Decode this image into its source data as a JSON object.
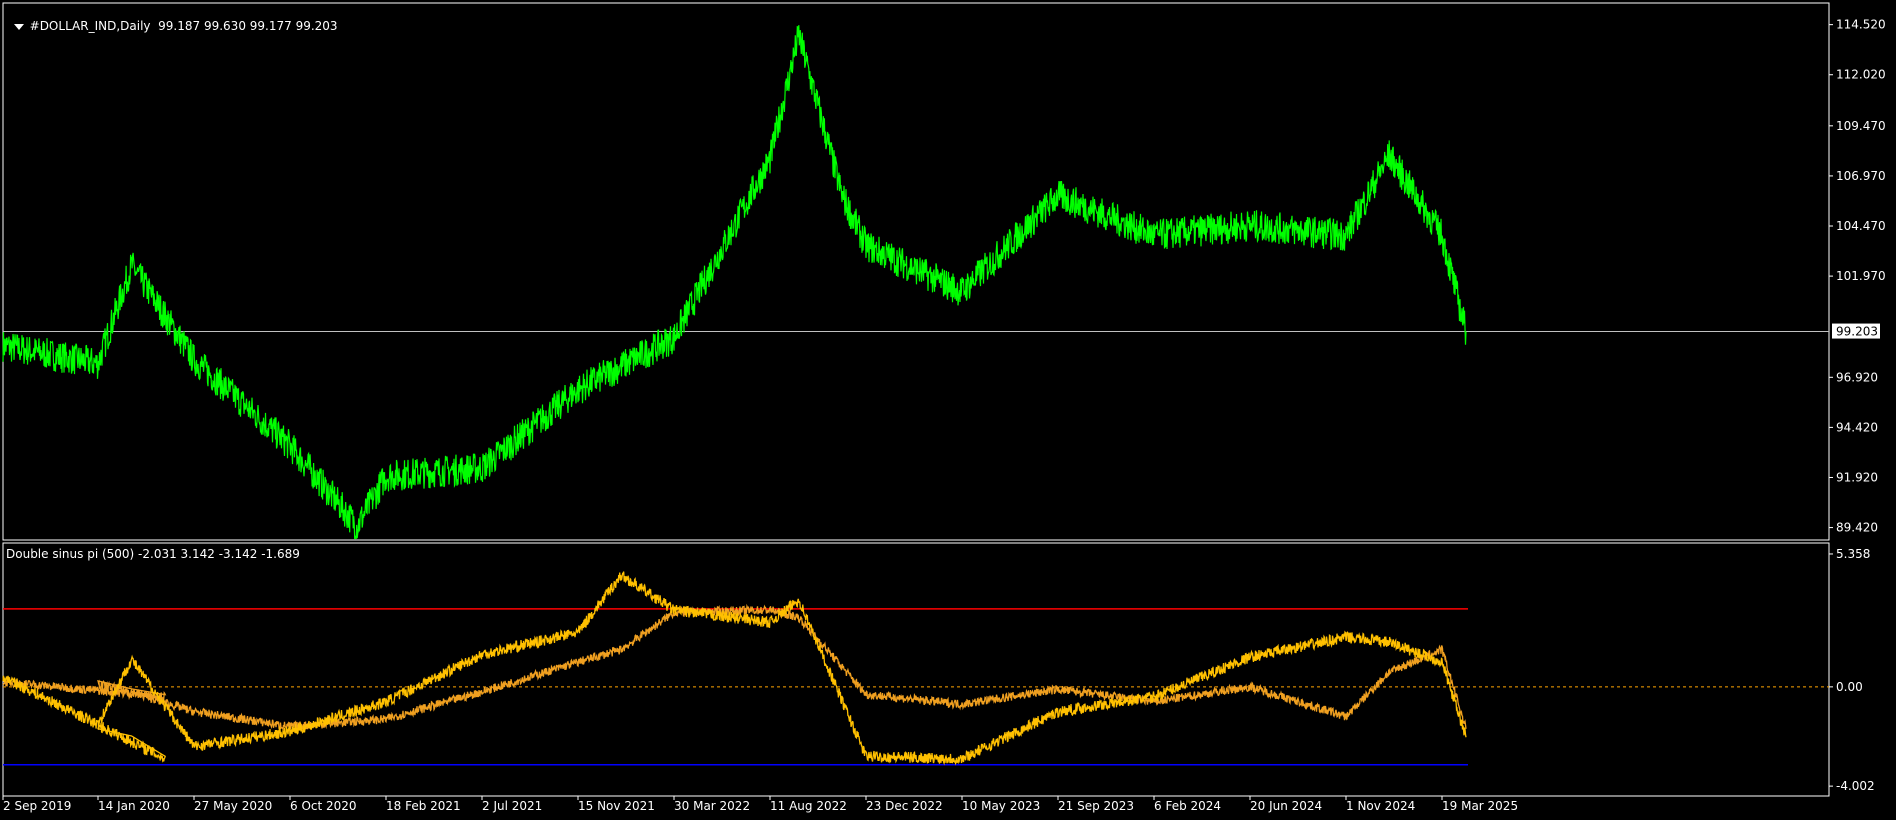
{
  "main_panel": {
    "symbol": "#DOLLAR_IND,Daily",
    "ohlc": "99.187 99.630 99.177 99.203",
    "current_price_label": "99.203",
    "current_price": 99.203
  },
  "indicator_panel": {
    "title": "Double sinus pi (500) -2.031 3.142 -3.142 -1.689"
  },
  "colors": {
    "background": "#000000",
    "frame": "#ffffff",
    "price_line": "#00ff00",
    "current_price_line": "#c0c0c0",
    "indicator_line_1": "#ffc000",
    "indicator_line_2": "#f0a020",
    "upper_level": "#ff0000",
    "lower_level": "#0000ff",
    "zero_level": "#ffa500"
  },
  "chart_data": [
    {
      "type": "line",
      "title": "#DOLLAR_IND,Daily",
      "y_ticks": [
        "114.520",
        "112.020",
        "109.470",
        "106.970",
        "104.470",
        "101.970",
        "99.203",
        "96.920",
        "94.420",
        "91.920",
        "89.420"
      ],
      "y_tick_values": [
        114.52,
        112.02,
        109.47,
        106.97,
        104.47,
        101.97,
        99.203,
        96.92,
        94.42,
        91.92,
        89.42
      ],
      "ylim": [
        88.8,
        115.6
      ],
      "x_tick_labels": [
        "2 Sep 2019",
        "14 Jan 2020",
        "27 May 2020",
        "6 Oct 2020",
        "18 Feb 2021",
        "2 Jul 2021",
        "15 Nov 2021",
        "30 Mar 2022",
        "11 Aug 2022",
        "23 Dec 2022",
        "10 May 2023",
        "21 Sep 2023",
        "6 Feb 2024",
        "20 Jun 2024",
        "1 Nov 2024",
        "19 Mar 2025"
      ],
      "series": [
        {
          "x": [
            "2 Sep 2019",
            "14 Jan 2020",
            "Mar 2020",
            "27 May 2020",
            "6 Oct 2020",
            "Jan 2021",
            "18 Feb 2021",
            "2 Jul 2021",
            "15 Nov 2021",
            "30 Mar 2022",
            "11 Aug 2022",
            "Sep 2022",
            "Nov 2022",
            "23 Dec 2022",
            "10 May 2023",
            "21 Sep 2023",
            "6 Feb 2024",
            "20 Jun 2024",
            "1 Nov 2024",
            "Jan 2025",
            "19 Mar 2025",
            "Apr 2025"
          ],
          "values": [
            98.5,
            97.6,
            102.5,
            97.8,
            93.5,
            89.5,
            92.0,
            92.4,
            96.3,
            98.9,
            107.8,
            114.0,
            106.0,
            103.5,
            101.2,
            106.0,
            104.0,
            104.5,
            104.0,
            108.0,
            104.0,
            99.2
          ]
        }
      ]
    },
    {
      "type": "line",
      "title": "Double sinus pi (500)",
      "y_ticks": [
        "5.358",
        "0.00",
        "-4.002"
      ],
      "y_tick_values": [
        5.358,
        0,
        -4.002
      ],
      "ylim": [
        -4.4,
        5.8
      ],
      "levels": {
        "upper": 3.142,
        "zero": 0,
        "lower": -3.142
      },
      "x_tick_labels": [
        "2 Sep 2019",
        "14 Jan 2020",
        "27 May 2020",
        "6 Oct 2020",
        "18 Feb 2021",
        "2 Jul 2021",
        "15 Nov 2021",
        "30 Mar 2022",
        "11 Aug 2022",
        "23 Dec 2022",
        "10 May 2023",
        "21 Sep 2023",
        "6 Feb 2024",
        "20 Jun 2024",
        "1 Nov 2024",
        "19 Mar 2025"
      ],
      "series": [
        {
          "x": [
            "2 Sep 2019",
            "Dec 2019",
            "14 Jan 2020",
            "Mar 2020",
            "27 May 2020",
            "6 Oct 2020",
            "18 Feb 2021",
            "2 Jul 2021",
            "15 Nov 2021",
            "Jan 2022",
            "30 Mar 2022",
            "11 Aug 2022",
            "Sep 2022",
            "23 Dec 2022",
            "10 May 2023",
            "21 Sep 2023",
            "6 Feb 2024",
            "20 Jun 2024",
            "1 Nov 2024",
            "Jan 2025",
            "19 Mar 2025",
            "Apr 2025"
          ],
          "values": [
            0.4,
            -2.9,
            -1.5,
            1.1,
            -2.4,
            -1.8,
            -0.6,
            1.3,
            2.2,
            4.5,
            3.1,
            2.6,
            3.5,
            -2.8,
            -2.9,
            -1.0,
            -0.4,
            1.2,
            2.0,
            1.8,
            1.0,
            -2.03
          ]
        },
        {
          "x": [
            "2 Sep 2019",
            "Dec 2019",
            "14 Jan 2020",
            "Mar 2020",
            "27 May 2020",
            "6 Oct 2020",
            "18 Feb 2021",
            "2 Jul 2021",
            "15 Nov 2021",
            "Jan 2022",
            "30 Mar 2022",
            "11 Aug 2022",
            "Sep 2022",
            "23 Dec 2022",
            "10 May 2023",
            "21 Sep 2023",
            "6 Feb 2024",
            "20 Jun 2024",
            "1 Nov 2024",
            "Jan 2025",
            "19 Mar 2025",
            "Apr 2025"
          ],
          "values": [
            0.2,
            -0.4,
            0.1,
            -0.2,
            -1.0,
            -1.6,
            -1.3,
            -0.2,
            1.0,
            1.5,
            3.0,
            3.1,
            2.8,
            -0.3,
            -0.7,
            -0.1,
            -0.6,
            0.0,
            -1.2,
            0.6,
            1.5,
            -1.69
          ]
        }
      ]
    }
  ]
}
